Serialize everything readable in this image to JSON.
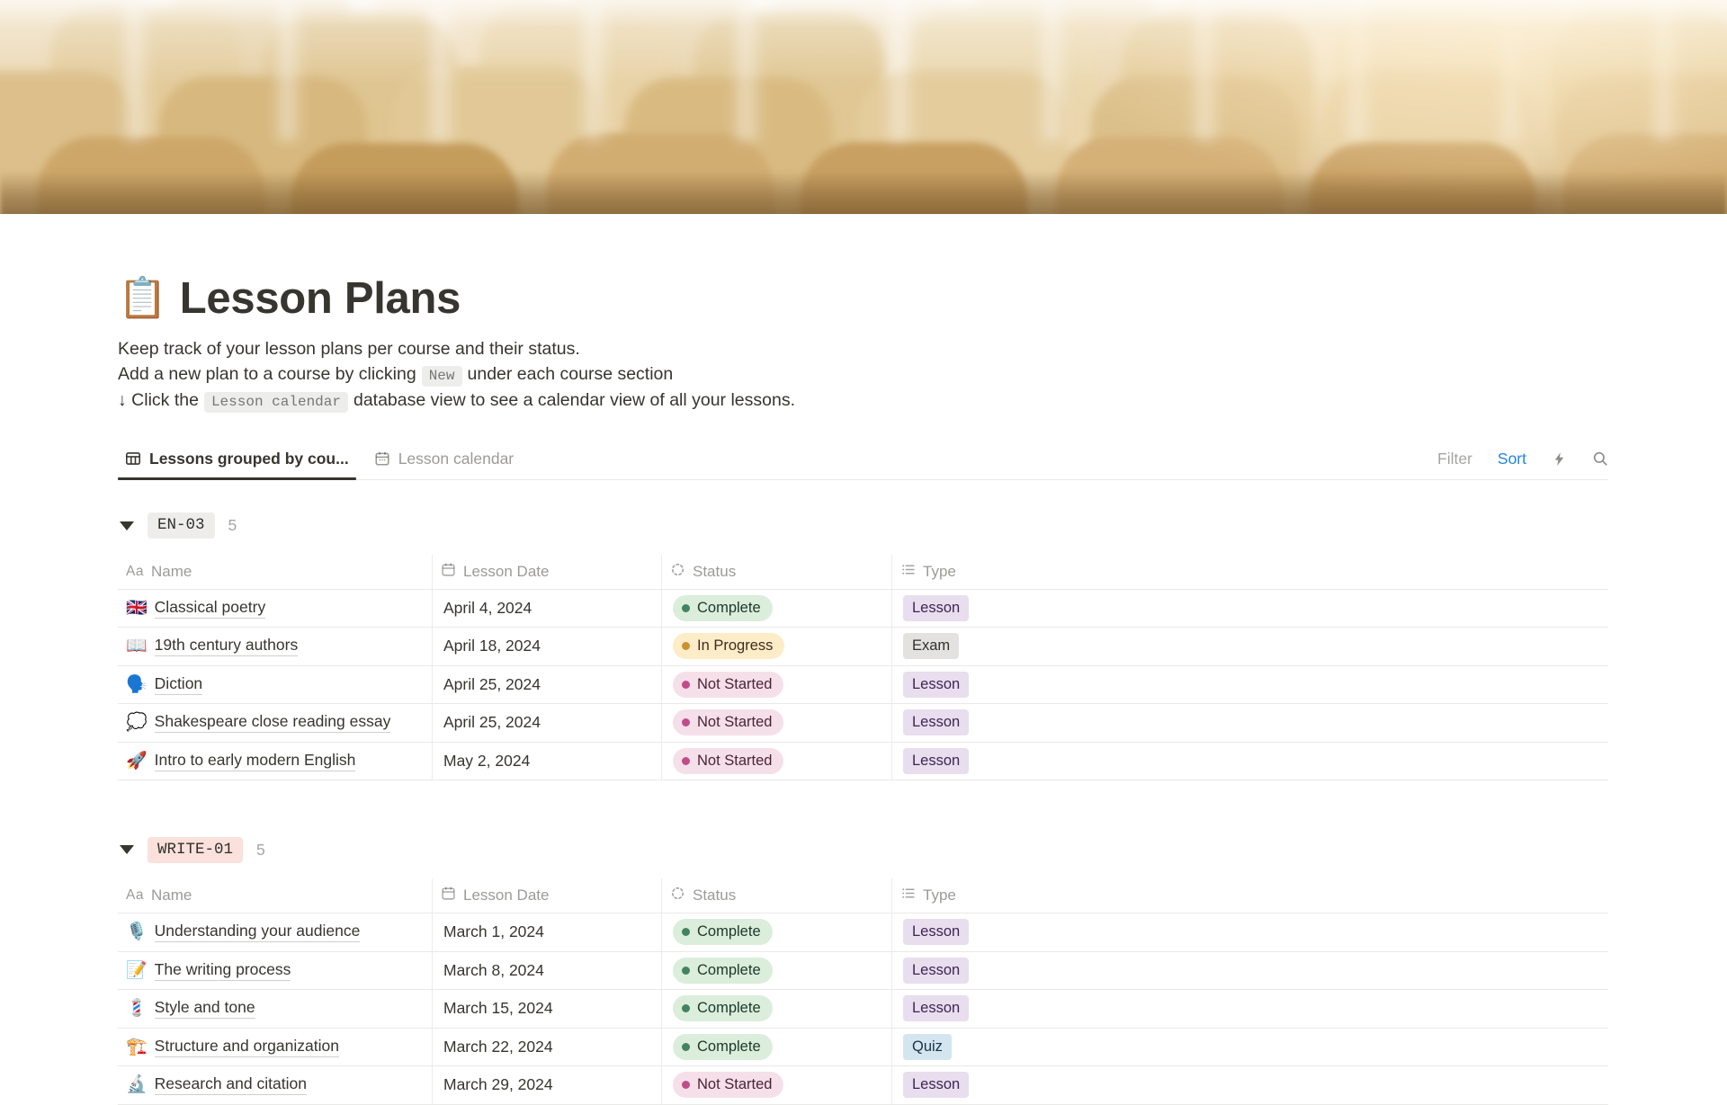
{
  "page": {
    "icon": "📋",
    "title": "Lesson Plans",
    "cover": "blurred-lecture-hall-wooden-seats-photo"
  },
  "description": {
    "line1": "Keep track of your lesson plans per course and their status.",
    "line2_pre": "Add a new plan to a course by clicking",
    "line2_code": "New",
    "line2_post": "under each course section",
    "line3_pre": "↓ Click the",
    "line3_code": "Lesson calendar",
    "line3_post": "database view to see a calendar view of all your lessons."
  },
  "tabs": {
    "grouped": {
      "label": "Lessons grouped by cou...",
      "icon": "table-view-icon",
      "active": true
    },
    "calendar": {
      "label": "Lesson calendar",
      "icon": "calendar-view-icon",
      "active": false
    }
  },
  "toolbar": {
    "filter": "Filter",
    "sort": "Sort",
    "icons": [
      "lightning-icon",
      "search-icon"
    ]
  },
  "columns": {
    "name_icon": "Aa",
    "name": "Name",
    "date": "Lesson Date",
    "status": "Status",
    "type": "Type"
  },
  "groups": [
    {
      "name": "EN-03",
      "count": "5",
      "badge_color": "gray",
      "rows": [
        {
          "emoji": "🇬🇧",
          "name": "Classical poetry",
          "date": "April 4, 2024",
          "status": "Complete",
          "type": "Lesson"
        },
        {
          "emoji": "📖",
          "name": "19th century authors",
          "date": "April 18, 2024",
          "status": "In Progress",
          "type": "Exam"
        },
        {
          "emoji": "🗣️",
          "name": "Diction",
          "date": "April 25, 2024",
          "status": "Not Started",
          "type": "Lesson"
        },
        {
          "emoji": "💭",
          "name": "Shakespeare close reading essay",
          "date": "April 25, 2024",
          "status": "Not Started",
          "type": "Lesson"
        },
        {
          "emoji": "🚀",
          "name": "Intro to early modern English",
          "date": "May 2, 2024",
          "status": "Not Started",
          "type": "Lesson"
        }
      ]
    },
    {
      "name": "WRITE-01",
      "count": "5",
      "badge_color": "red",
      "rows": [
        {
          "emoji": "🎙️",
          "name": "Understanding your audience",
          "date": "March 1, 2024",
          "status": "Complete",
          "type": "Lesson"
        },
        {
          "emoji": "📝",
          "name": "The writing process",
          "date": "March 8, 2024",
          "status": "Complete",
          "type": "Lesson"
        },
        {
          "emoji": "💈",
          "name": "Style and tone",
          "date": "March 15, 2024",
          "status": "Complete",
          "type": "Lesson"
        },
        {
          "emoji": "🏗️",
          "name": "Structure and organization",
          "date": "March 22, 2024",
          "status": "Complete",
          "type": "Quiz"
        },
        {
          "emoji": "🔬",
          "name": "Research and citation",
          "date": "March 29, 2024",
          "status": "Not Started",
          "type": "Lesson"
        }
      ]
    }
  ],
  "colors": {
    "accent_blue": "#2383E2",
    "text": "#37352F",
    "muted_text": "#9B9A97",
    "divider": "#E9E9E7",
    "status_complete_bg": "#DBEDDB",
    "status_complete_dot": "#448361",
    "status_inprogress_bg": "#FDECC8",
    "status_inprogress_dot": "#CB912F",
    "status_notstarted_bg": "#F5E0E9",
    "status_notstarted_dot": "#C14C8A",
    "type_lesson_bg": "#E8DEEE",
    "type_exam_bg": "#E3E2E0",
    "type_quiz_bg": "#D3E5EF",
    "group_en03_bg": "#EEEDEB",
    "group_write01_bg": "#FBE1DC",
    "code_bg": "rgba(135,131,120,0.15)"
  }
}
